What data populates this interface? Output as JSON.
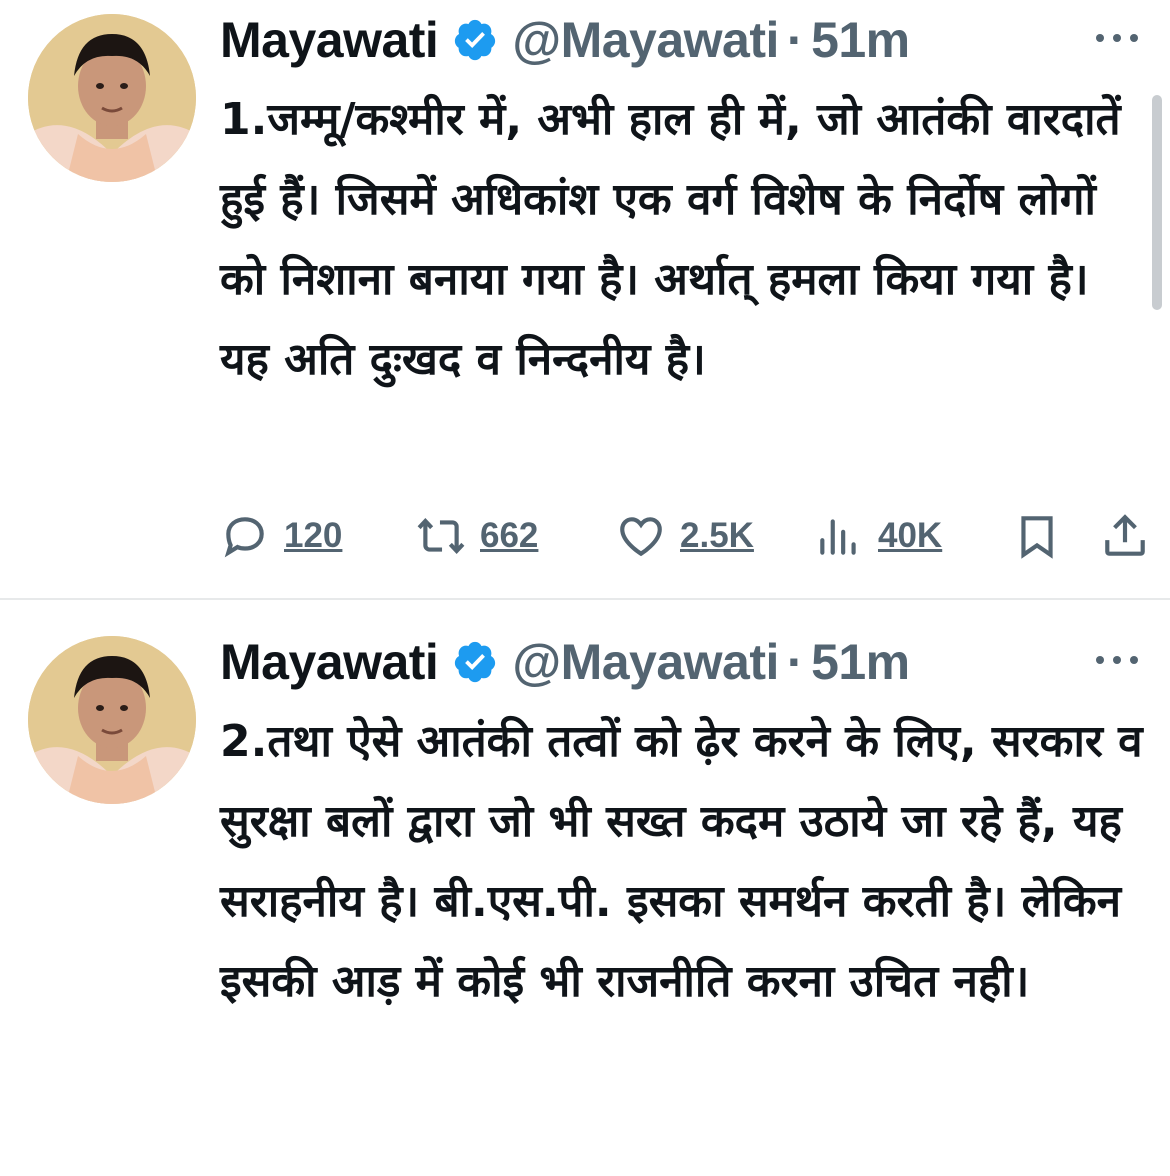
{
  "tweets": [
    {
      "author_name": "Mayawati",
      "handle": "@Mayawati",
      "separator": "·",
      "time": "51m",
      "text": "1.जम्मू/कश्मीर में, अभी हाल ही में, जो आतंकी वारदातें हुई हैं। जिसमें अधिकांश एक वर्ग विशेष के निर्दोष लोगों को निशाना बनाया गया है। अर्थात् हमला किया गया है। यह अति दुःखद व निन्दनीय है।",
      "replies": "120",
      "reposts": "662",
      "likes": "2.5K",
      "views": "40K"
    },
    {
      "author_name": "Mayawati",
      "handle": "@Mayawati",
      "separator": "·",
      "time": "51m",
      "text": "2.तथा ऐसे आतंकी तत्वों को ढ़ेर करने के लिए, सरकार व सुरक्षा बलों द्वारा जो भी सख्त कदम उठाये जा रहे हैं, यह सराहनीय है। बी.एस.पी. इसका समर्थन करती है। लेकिन इसकी आड़ में कोई भी राजनीति करना उचित नही।"
    }
  ],
  "icons": {
    "verified": "verified-badge-icon",
    "more": "more-options-icon",
    "reply": "reply-icon",
    "repost": "repost-icon",
    "like": "heart-icon",
    "views": "views-icon",
    "bookmark": "bookmark-icon",
    "share": "share-icon"
  },
  "colors": {
    "verified": "#1d9bf0",
    "text": "#0f1419",
    "secondary": "#536471",
    "divider": "#e7e9ea"
  }
}
